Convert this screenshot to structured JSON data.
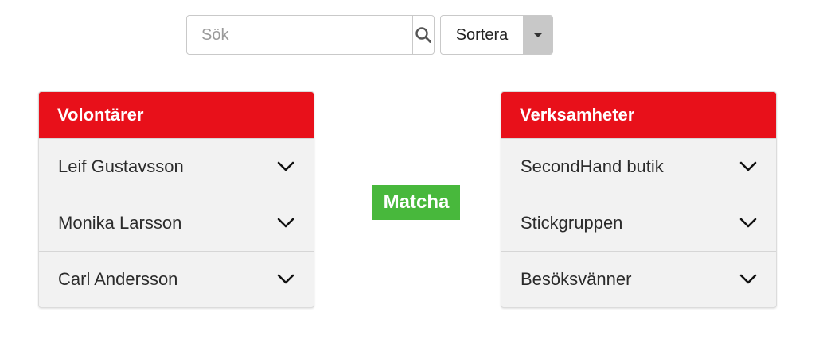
{
  "search": {
    "placeholder": "Sök",
    "value": ""
  },
  "sort": {
    "label": "Sortera"
  },
  "volunteers": {
    "title": "Volontärer",
    "items": [
      {
        "label": "Leif Gustavsson"
      },
      {
        "label": "Monika Larsson"
      },
      {
        "label": "Carl Andersson"
      }
    ]
  },
  "match": {
    "label": "Matcha"
  },
  "organizations": {
    "title": "Verksamheter",
    "items": [
      {
        "label": "SecondHand butik"
      },
      {
        "label": "Stickgruppen"
      },
      {
        "label": "Besöksvänner"
      }
    ]
  },
  "colors": {
    "header_red": "#e8101a",
    "match_green": "#48b83c",
    "panel_bg": "#f2f2f2",
    "caret_gray": "#c8c8c8"
  },
  "icons": {
    "search": "search-icon",
    "caret": "caret-down-icon",
    "row_toggle": "chevron-down-icon"
  }
}
